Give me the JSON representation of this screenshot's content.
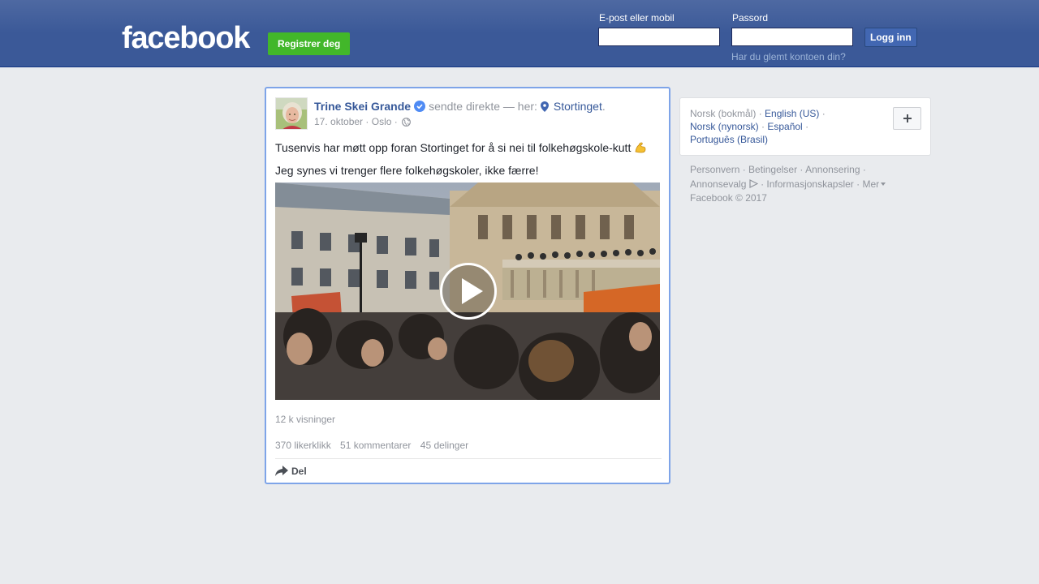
{
  "header": {
    "logo_text": "facebook",
    "register_label": "Registrer deg",
    "email_label": "E-post eller mobil",
    "password_label": "Passord",
    "login_label": "Logg inn",
    "forgot_label": "Har du glemt kontoen din?",
    "email_value": "",
    "password_value": ""
  },
  "post": {
    "author": "Trine Skei Grande",
    "action_text": "sendte direkte — her:",
    "place": "Stortinget",
    "place_suffix": ".",
    "date": "17. oktober",
    "location": "Oslo",
    "meta_separator": "·",
    "text_line1": "Tusenvis har møtt opp foran Stortinget for å si nei til folkehøgskole-kutt",
    "text_line2": "Jeg synes vi trenger flere folkehøgskoler, ikke færre!",
    "views": "12 k visninger",
    "likes": "370 likerklikk",
    "comments": "51 kommentarer",
    "shares": "45 delinger",
    "share_label": "Del"
  },
  "languages": {
    "current": "Norsk (bokmål)",
    "separator": " · ",
    "links": [
      "English (US)",
      "Norsk (nynorsk)",
      "Español",
      "Português (Brasil)"
    ]
  },
  "footer": {
    "links": [
      "Personvern",
      "Betingelser",
      "Annonsering",
      "Annonsevalg",
      "Informasjonskapsler",
      "Mer"
    ],
    "copyright": "Facebook © 2017"
  },
  "colors": {
    "topbar": "#3b5998",
    "link": "#365899",
    "register_green": "#42b72a",
    "highlight_border": "#7ea4e8"
  },
  "icons": {
    "verified": "verified-badge-icon",
    "place": "map-pin-icon",
    "privacy": "globe-icon",
    "emoji": "flexed-biceps-emoji",
    "play": "play-icon",
    "share": "share-arrow-icon",
    "add_language": "plus-icon"
  }
}
